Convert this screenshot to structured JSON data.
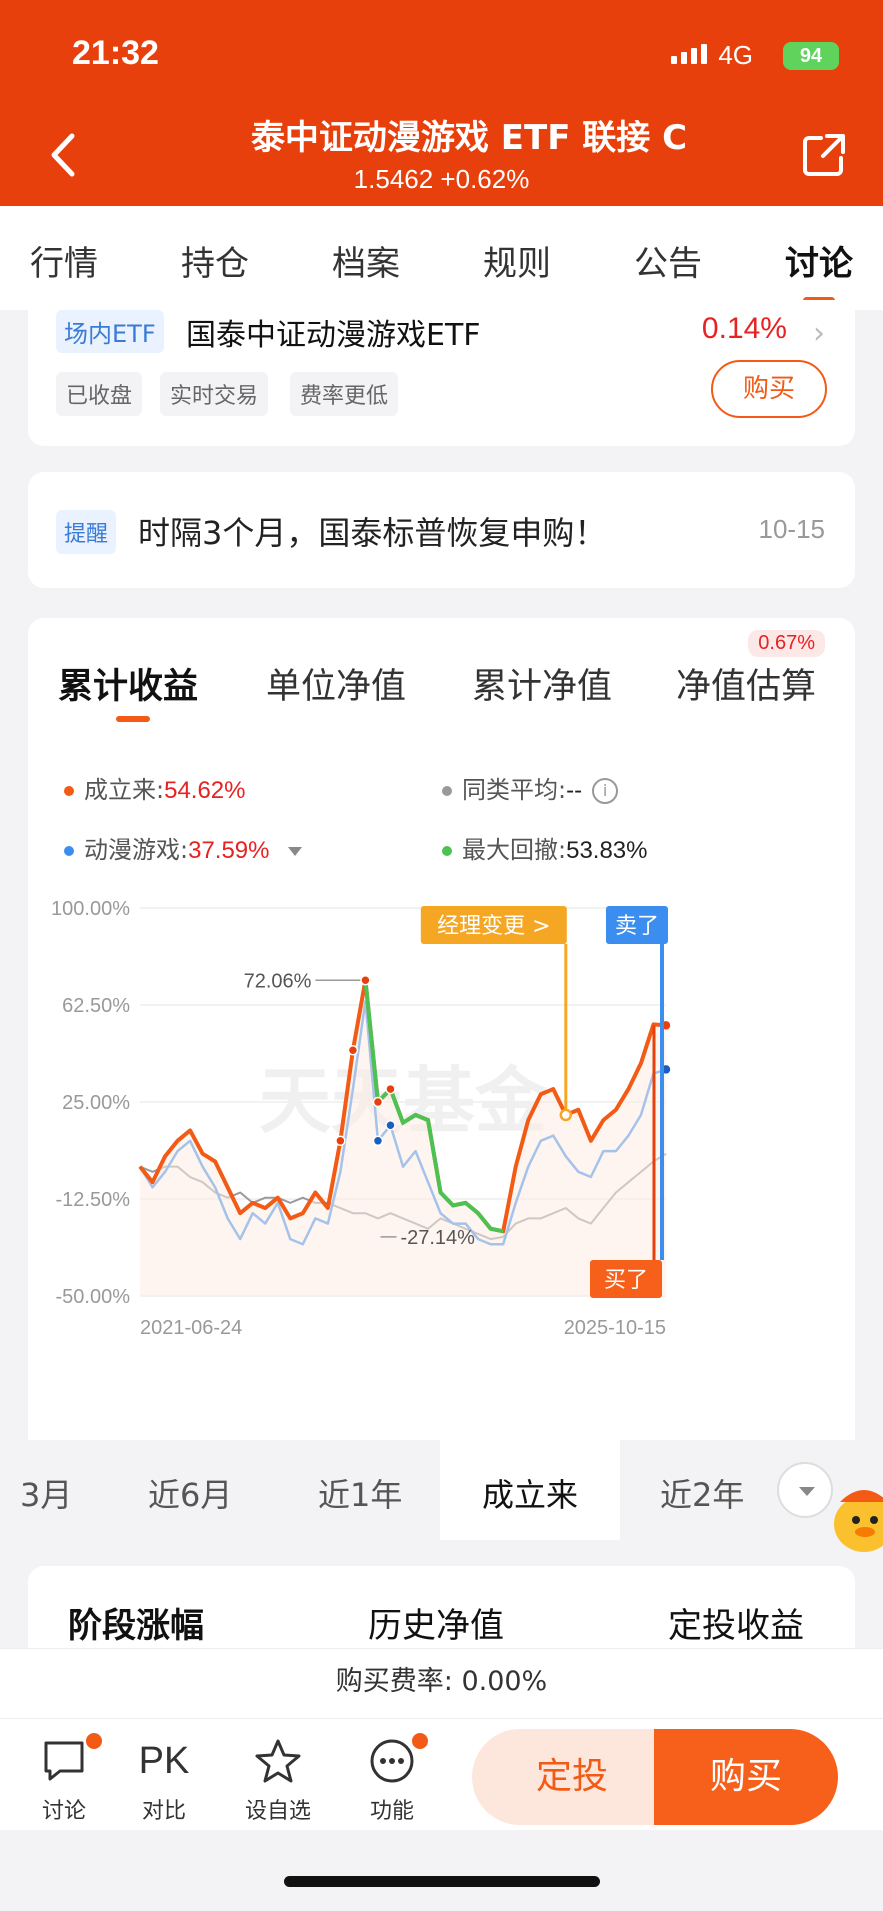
{
  "status_bar": {
    "time": "21:32",
    "network": "4G",
    "battery": "94"
  },
  "header": {
    "title": "泰中证动漫游戏 ETF 联接 C",
    "subtitle": "1.5462 +0.62%"
  },
  "tabs": [
    {
      "label": "行情"
    },
    {
      "label": "持仓"
    },
    {
      "label": "档案"
    },
    {
      "label": "规则"
    },
    {
      "label": "公告"
    },
    {
      "label": "讨论"
    }
  ],
  "etf": {
    "tag": "场内ETF",
    "name": "国泰中证动漫游戏ETF",
    "change": "0.14%",
    "chips": [
      "已收盘",
      "实时交易",
      "费率更低"
    ],
    "buy_label": "购买"
  },
  "notice": {
    "tag": "提醒",
    "text": "时隔3个月，国泰标普恢复申购！",
    "date": "10-15"
  },
  "chart_tabs": {
    "items": [
      {
        "label": "累计收益"
      },
      {
        "label": "单位净值"
      },
      {
        "label": "累计净值"
      },
      {
        "label": "净值估算"
      }
    ],
    "estimate_badge": "0.67%"
  },
  "legend": {
    "since_inception": {
      "label": "成立来:",
      "value": "54.62%",
      "color": "#f25a15"
    },
    "peer_avg": {
      "label": "同类平均:",
      "value": "--",
      "color": "#999999"
    },
    "benchmark": {
      "label": "动漫游戏:",
      "value": "37.59%",
      "color": "#3b8ef0"
    },
    "max_drawdown": {
      "label": "最大回撤:",
      "value": "53.83%",
      "color": "#4cc252"
    }
  },
  "annotations": {
    "manager_change": "经理变更 >",
    "sell": "卖了",
    "buy": "买了",
    "peak": "72.06%",
    "trough": "-27.14%",
    "watermark": "天天基金"
  },
  "chart_data": {
    "type": "line",
    "ylim": [
      -50,
      100
    ],
    "y_ticks": [
      "100.00%",
      "62.50%",
      "25.00%",
      "-12.50%",
      "-50.00%"
    ],
    "x_labels": [
      "2021-06-24",
      "2025-10-15"
    ],
    "series": [
      {
        "name": "成立来",
        "color": "#f25a15",
        "values": [
          0,
          -6,
          4,
          10,
          14,
          5,
          2,
          -8,
          -18,
          -14,
          -16,
          -12,
          -20,
          -18,
          -10,
          -16,
          10,
          45,
          72.06,
          25,
          30,
          17,
          20,
          18,
          -10,
          -15,
          -14,
          -18,
          -24,
          -25,
          0,
          18,
          28,
          30,
          20,
          22,
          10,
          18,
          22,
          30,
          40,
          55,
          54.62
        ]
      },
      {
        "name": "动漫游戏",
        "values": [
          0,
          -8,
          -2,
          6,
          10,
          0,
          -8,
          -20,
          -28,
          -18,
          -22,
          -14,
          -28,
          -30,
          -20,
          -22,
          -2,
          30,
          64,
          10,
          16,
          0,
          6,
          -6,
          -18,
          -22,
          -22,
          -28,
          -30,
          -30,
          -14,
          0,
          10,
          12,
          4,
          -2,
          -4,
          6,
          6,
          12,
          20,
          36,
          37.59
        ]
      },
      {
        "name": "同类平均",
        "values": [
          0,
          -2,
          0,
          0,
          -4,
          -6,
          -10,
          -12,
          -10,
          -14,
          -12,
          -12,
          -14,
          -12,
          -14,
          -14,
          -16,
          -18,
          -18,
          -20,
          -18,
          -20,
          -22,
          -24,
          -20,
          -22,
          -24,
          -26,
          -28,
          -27.14,
          -22,
          -20,
          -20,
          -18,
          -16,
          -20,
          -22,
          -16,
          -10,
          -6,
          -2,
          2,
          5
        ]
      }
    ],
    "max_drawdown": "53.83%"
  },
  "range_tabs": [
    {
      "label": "3月"
    },
    {
      "label": "近6月"
    },
    {
      "label": "近1年"
    },
    {
      "label": "成立来"
    },
    {
      "label": "近2年"
    }
  ],
  "section_tabs": [
    {
      "label": "阶段涨幅"
    },
    {
      "label": "历史净值"
    },
    {
      "label": "定投收益"
    }
  ],
  "fee": "购买费率: 0.00%",
  "toolbar": {
    "items": [
      {
        "label": "讨论"
      },
      {
        "label": "对比"
      },
      {
        "label": "设自选"
      },
      {
        "label": "功能"
      }
    ],
    "pk": "PK",
    "dingtou": "定投",
    "buy": "购买"
  }
}
